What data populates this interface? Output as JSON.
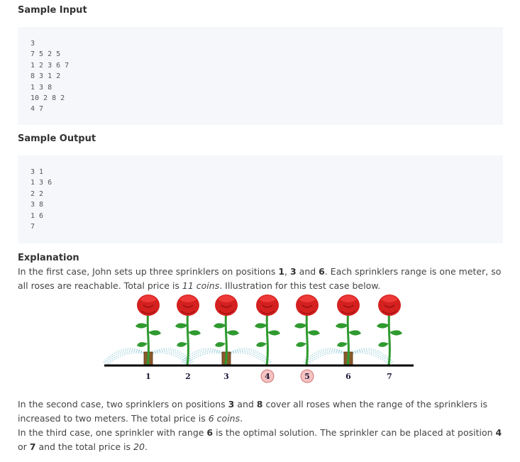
{
  "sample_input": {
    "title": "Sample Input",
    "text": "3\n7 5 2 5\n1 2 3 6 7\n8 3 1 2\n1 3 8\n10 2 8 2\n4 7"
  },
  "sample_output": {
    "title": "Sample Output",
    "text": "3 1\n1 3 6\n2 2\n3 8\n1 6\n7"
  },
  "explanation": {
    "title": "Explanation",
    "p1": {
      "a": "In the first case, John sets up three sprinklers on positions ",
      "n1": "1",
      "s1": ", ",
      "n2": "3",
      "s2": " and ",
      "n3": "6",
      "b": ". Each sprinklers range is one meter, so all roses are reachable. Total price is ",
      "price": "11 coins",
      "c": ". Illustration for this test case below."
    },
    "p2": {
      "a": "In the second case, two sprinklers on positions ",
      "n1": "3",
      "s1": " and ",
      "n2": "8",
      "b": " cover all roses when the range of the sprinklers is increased to two meters. The total price is ",
      "price": "6 coins",
      "c": "."
    },
    "p3": {
      "a": "In the third case, one sprinkler with range ",
      "n1": "6",
      "b": " is the optimal solution. The sprinkler can be placed at position ",
      "n2": "4",
      "s1": " or ",
      "n3": "7",
      "c": " and the total price is ",
      "price": "20",
      "d": "."
    }
  },
  "illustration": {
    "positions": [
      "1",
      "2",
      "3",
      "4",
      "5",
      "6",
      "7"
    ],
    "highlighted": [
      4,
      5
    ],
    "sprinklers": [
      1,
      3,
      6
    ],
    "colors": {
      "rose": "#d4201f",
      "stem": "#2f9a2f",
      "highlight": "#f6c2c2"
    }
  }
}
